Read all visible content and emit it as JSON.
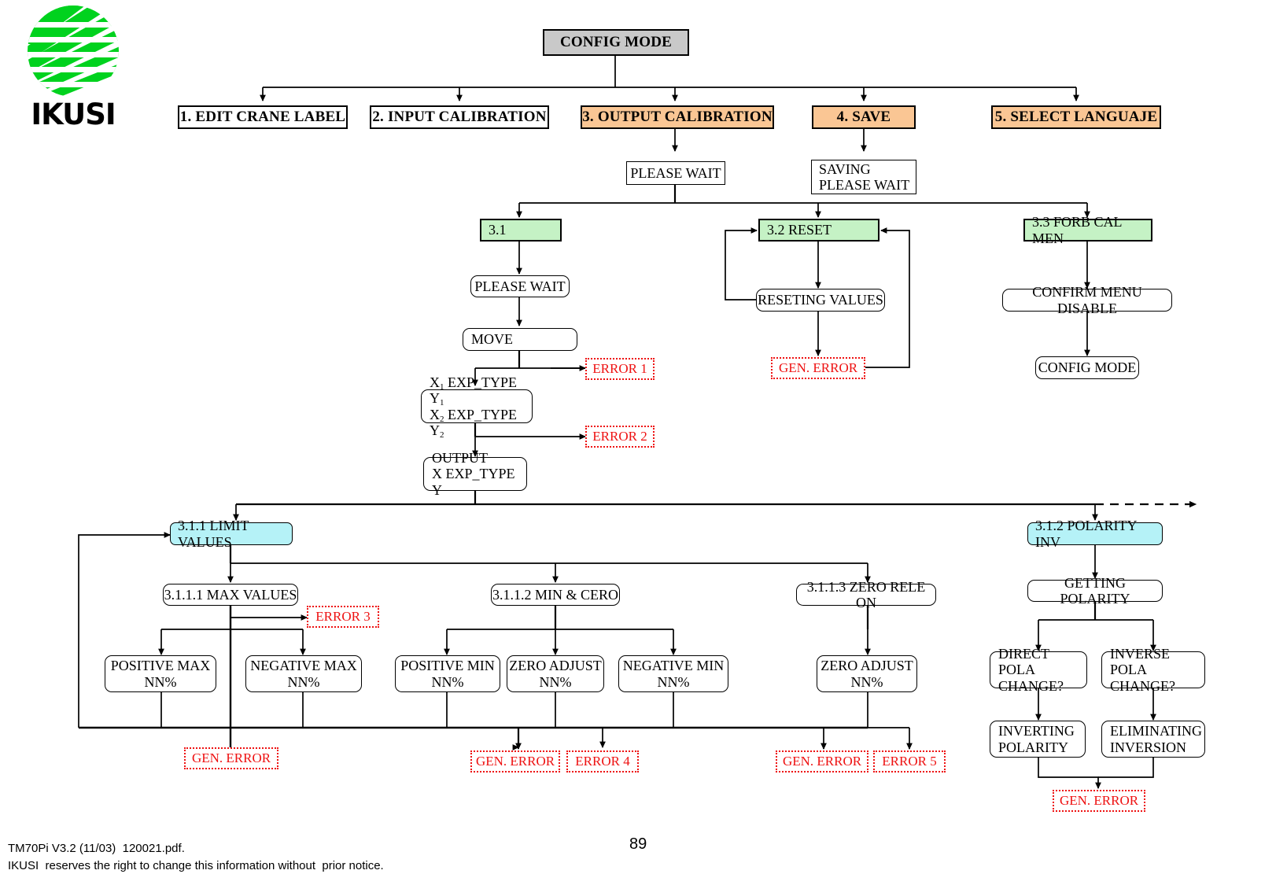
{
  "brand": {
    "name": "IKUSI",
    "logo_icon": "ikusi-striped-globe-icon"
  },
  "title": {
    "label": "CONFIG MODE"
  },
  "colors": {
    "title_bg": "#c9c9c9",
    "menu_highlight_bg": "#fac694",
    "submenu_bg": "#c5f2c5",
    "leaf_menu_bg": "#b5f2f7",
    "error_fg": "#ee1111"
  },
  "main_menu": [
    {
      "label": "1. EDIT CRANE LABEL",
      "highlighted": false
    },
    {
      "label": "2. INPUT CALIBRATION",
      "highlighted": false
    },
    {
      "label": "3. OUTPUT CALIBRATION",
      "highlighted": true
    },
    {
      "label": "4. SAVE",
      "highlighted": true
    },
    {
      "label": "5. SELECT LANGUAJE",
      "highlighted": true
    }
  ],
  "messages": {
    "please_wait": "PLEASE WAIT",
    "saving_please_wait": "SAVING\nPLEASE WAIT",
    "please_wait_2": "PLEASE WAIT",
    "move": "MOVE",
    "reseting_values": "RESETING VALUES",
    "confirm_menu_disable": "CONFIRM MENU DISABLE",
    "config_mode_return": "CONFIG MODE",
    "getting_polarity": "GETTING POLARITY"
  },
  "submenus": {
    "s31": "3.1",
    "s32": "3.2 RESET",
    "s33": "3.3 FORB CAL MEN",
    "s311": "3.1.1 LIMIT VALUES",
    "s312": "3.1.2 POLARITY INV"
  },
  "exp": {
    "two_point_line1_pre": "X",
    "two_point_line1_sub": "1",
    "two_point_line1_mid": " EXP_TYPE Y",
    "two_point_line1_sub2": "1",
    "two_point_line2_pre": "X",
    "two_point_line2_sub": "2",
    "two_point_line2_mid": " EXP_TYPE Y",
    "two_point_line2_sub2": "2",
    "output_line1": "OUTPUT",
    "output_line2": "X EXP_TYPE Y"
  },
  "limit_children": [
    {
      "label": "3.1.1.1 MAX VALUES"
    },
    {
      "label": "3.1.1.2 MIN & CERO"
    },
    {
      "label": "3.1.1.3 ZERO RELE ON"
    }
  ],
  "value_boxes": [
    {
      "line1": "POSITIVE  MAX",
      "line2": "NN%"
    },
    {
      "line1": "NEGATIVE  MAX",
      "line2": "NN%"
    },
    {
      "line1": "POSITIVE MIN",
      "line2": "NN%"
    },
    {
      "line1": "ZERO ADJUST",
      "line2": "NN%"
    },
    {
      "line1": "NEGATIVE MIN",
      "line2": "NN%"
    },
    {
      "line1": "ZERO ADJUST",
      "line2": "NN%"
    }
  ],
  "polarity": {
    "direct": "DIRECT POLA\nCHANGE?",
    "inverse": "INVERSE POLA\nCHANGE?",
    "inverting": "INVERTING\nPOLARITY",
    "eliminating": "ELIMINATING\nINVERSION"
  },
  "errors": {
    "e1": "ERROR 1",
    "e2": "ERROR 2",
    "e3": "ERROR 3",
    "e4": "ERROR 4",
    "e5": "ERROR 5",
    "gen_reset": "GEN. ERROR",
    "gen_max": "GEN. ERROR",
    "gen_min": "GEN. ERROR",
    "gen_zero": "GEN. ERROR",
    "gen_polarity": "GEN. ERROR"
  },
  "footer": {
    "line1": "TM70Pi V3.2 (11/03)  120021.pdf.",
    "line2": "IKUSI  reserves the right to change this information without  prior notice.",
    "page": "89"
  }
}
